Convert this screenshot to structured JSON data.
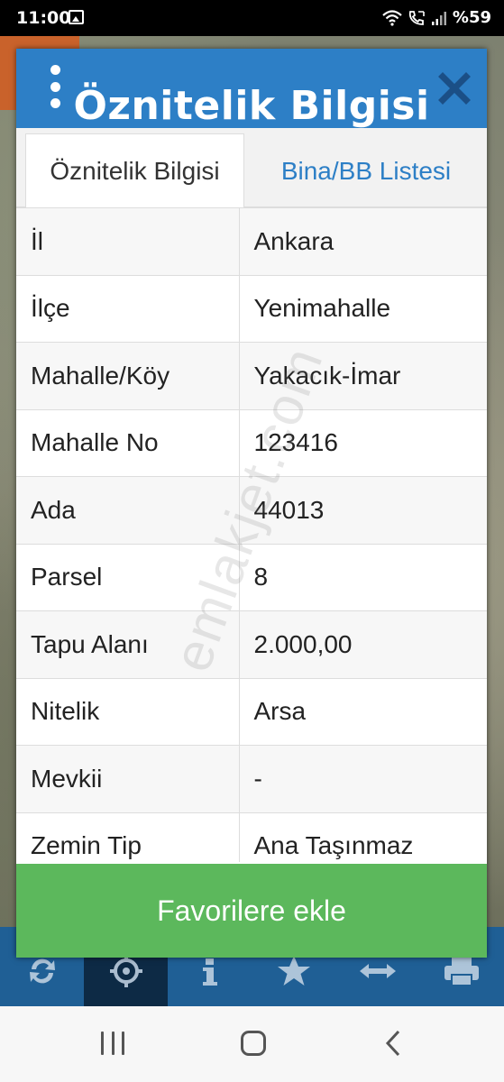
{
  "status_bar": {
    "time": "11:00",
    "battery": "%59",
    "icons": [
      "image-icon",
      "wifi-icon",
      "call-icon",
      "signal-icon"
    ]
  },
  "dialog": {
    "title": "Öznitelik Bilgisi",
    "icons": [
      "menu-dots-icon",
      "close-icon"
    ],
    "tabs": [
      {
        "label": "Öznitelik Bilgisi",
        "active": true
      },
      {
        "label": "Bina/BB Listesi",
        "active": false
      }
    ],
    "rows": [
      {
        "key": "İl",
        "value": "Ankara"
      },
      {
        "key": "İlçe",
        "value": "Yenimahalle"
      },
      {
        "key": "Mahalle/Köy",
        "value": "Yakacık-İmar"
      },
      {
        "key": "Mahalle No",
        "value": "123416"
      },
      {
        "key": "Ada",
        "value": "44013"
      },
      {
        "key": "Parsel",
        "value": "8"
      },
      {
        "key": "Tapu Alanı",
        "value": "2.000,00"
      },
      {
        "key": "Nitelik",
        "value": "Arsa"
      },
      {
        "key": "Mevkii",
        "value": "-"
      },
      {
        "key": "Zemin Tip",
        "value": "Ana Taşınmaz"
      }
    ],
    "favorite_button": "Favorilere ekle",
    "watermark": "emlakjet.com"
  },
  "toolbar": {
    "icons": [
      "refresh-icon",
      "locate-icon",
      "info-icon",
      "star-icon",
      "measure-icon",
      "print-icon"
    ]
  },
  "colors": {
    "header_blue": "#2d7fc6",
    "button_green": "#5cb85c",
    "toolbar_blue": "#1f5f95"
  }
}
